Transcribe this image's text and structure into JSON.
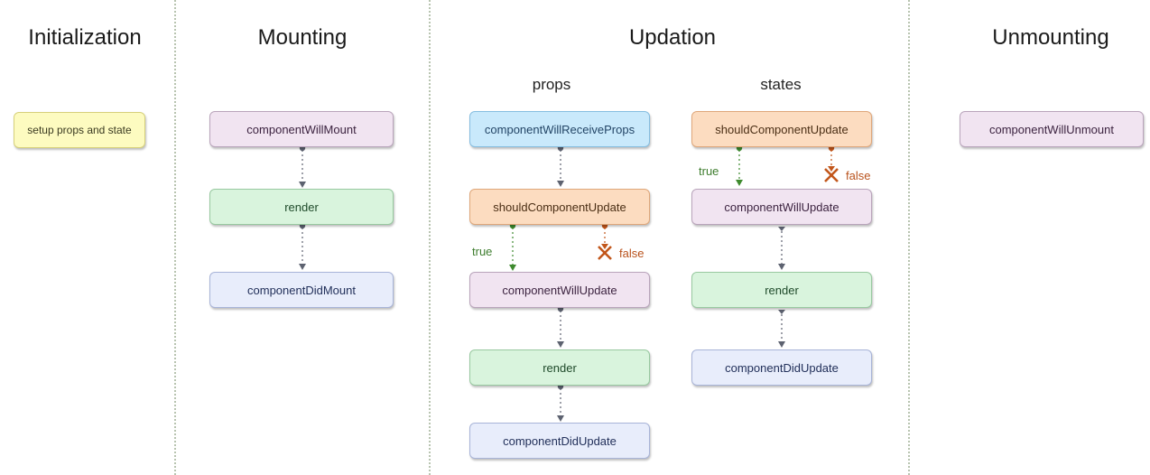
{
  "phases": {
    "initialization": "Initialization",
    "mounting": "Mounting",
    "updation": "Updation",
    "unmounting": "Unmounting"
  },
  "updation_subsections": {
    "props": "props",
    "states": "states"
  },
  "nodes": {
    "init_setup": "setup props and state",
    "mount_will": "componentWillMount",
    "mount_render": "render",
    "mount_did": "componentDidMount",
    "props_receive": "componentWillReceiveProps",
    "props_should": "shouldComponentUpdate",
    "props_will": "componentWillUpdate",
    "props_render": "render",
    "props_did": "componentDidUpdate",
    "states_should": "shouldComponentUpdate",
    "states_will": "componentWillUpdate",
    "states_render": "render",
    "states_did": "componentDidUpdate",
    "unmount_will": "componentWillUnmount"
  },
  "edge_labels": {
    "props_true": "true",
    "props_false": "false",
    "states_true": "true",
    "states_false": "false"
  },
  "colors": {
    "true_branch": "#3e8a2e",
    "false_branch": "#c2561a",
    "connector": "#5d6270"
  }
}
